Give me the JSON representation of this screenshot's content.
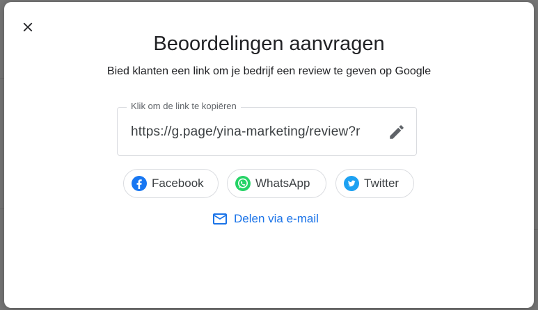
{
  "dialog": {
    "title": "Beoordelingen aanvragen",
    "subtitle": "Bied klanten een link om je bedrijf een review te geven op Google",
    "link_field": {
      "label": "Klik om de link te kopiëren",
      "value": "https://g.page/yina-marketing/review?r"
    },
    "share": {
      "facebook_label": "Facebook",
      "whatsapp_label": "WhatsApp",
      "twitter_label": "Twitter",
      "email_label": "Delen via e-mail"
    }
  },
  "icons": {
    "close": "close-icon",
    "edit": "pencil-icon",
    "facebook": "facebook-icon",
    "whatsapp": "whatsapp-icon",
    "twitter": "twitter-icon",
    "email": "mail-icon"
  },
  "colors": {
    "accent": "#1a73e8",
    "facebook": "#1877f2",
    "whatsapp": "#25d366",
    "twitter": "#1da1f2"
  }
}
